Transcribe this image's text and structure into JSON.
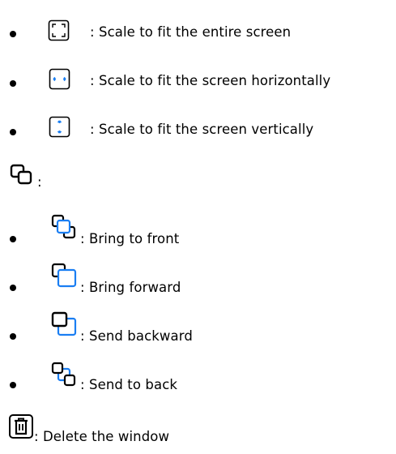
{
  "items": {
    "fit_entire": {
      "icon": "fit-entire-screen-icon",
      "label": ": Scale to fit the entire screen"
    },
    "fit_horizontal": {
      "icon": "fit-horizontal-icon",
      "label": ": Scale to fit the screen horizontally"
    },
    "fit_vertical": {
      "icon": "fit-vertical-icon",
      "label": ": Scale to fit the screen vertically"
    },
    "layer_heading": {
      "icon": "layer-order-icon",
      "label": ":"
    },
    "bring_front": {
      "icon": "bring-to-front-icon",
      "label": ": Bring to front"
    },
    "bring_forward": {
      "icon": "bring-forward-icon",
      "label": ": Bring forward"
    },
    "send_backward": {
      "icon": "send-backward-icon",
      "label": ": Send backward"
    },
    "send_back": {
      "icon": "send-to-back-icon",
      "label": ": Send to back"
    },
    "delete_window": {
      "icon": "trash-icon",
      "label": ": Delete the window"
    }
  },
  "colors": {
    "accent": "#1a7ef2",
    "ink": "#000000"
  }
}
